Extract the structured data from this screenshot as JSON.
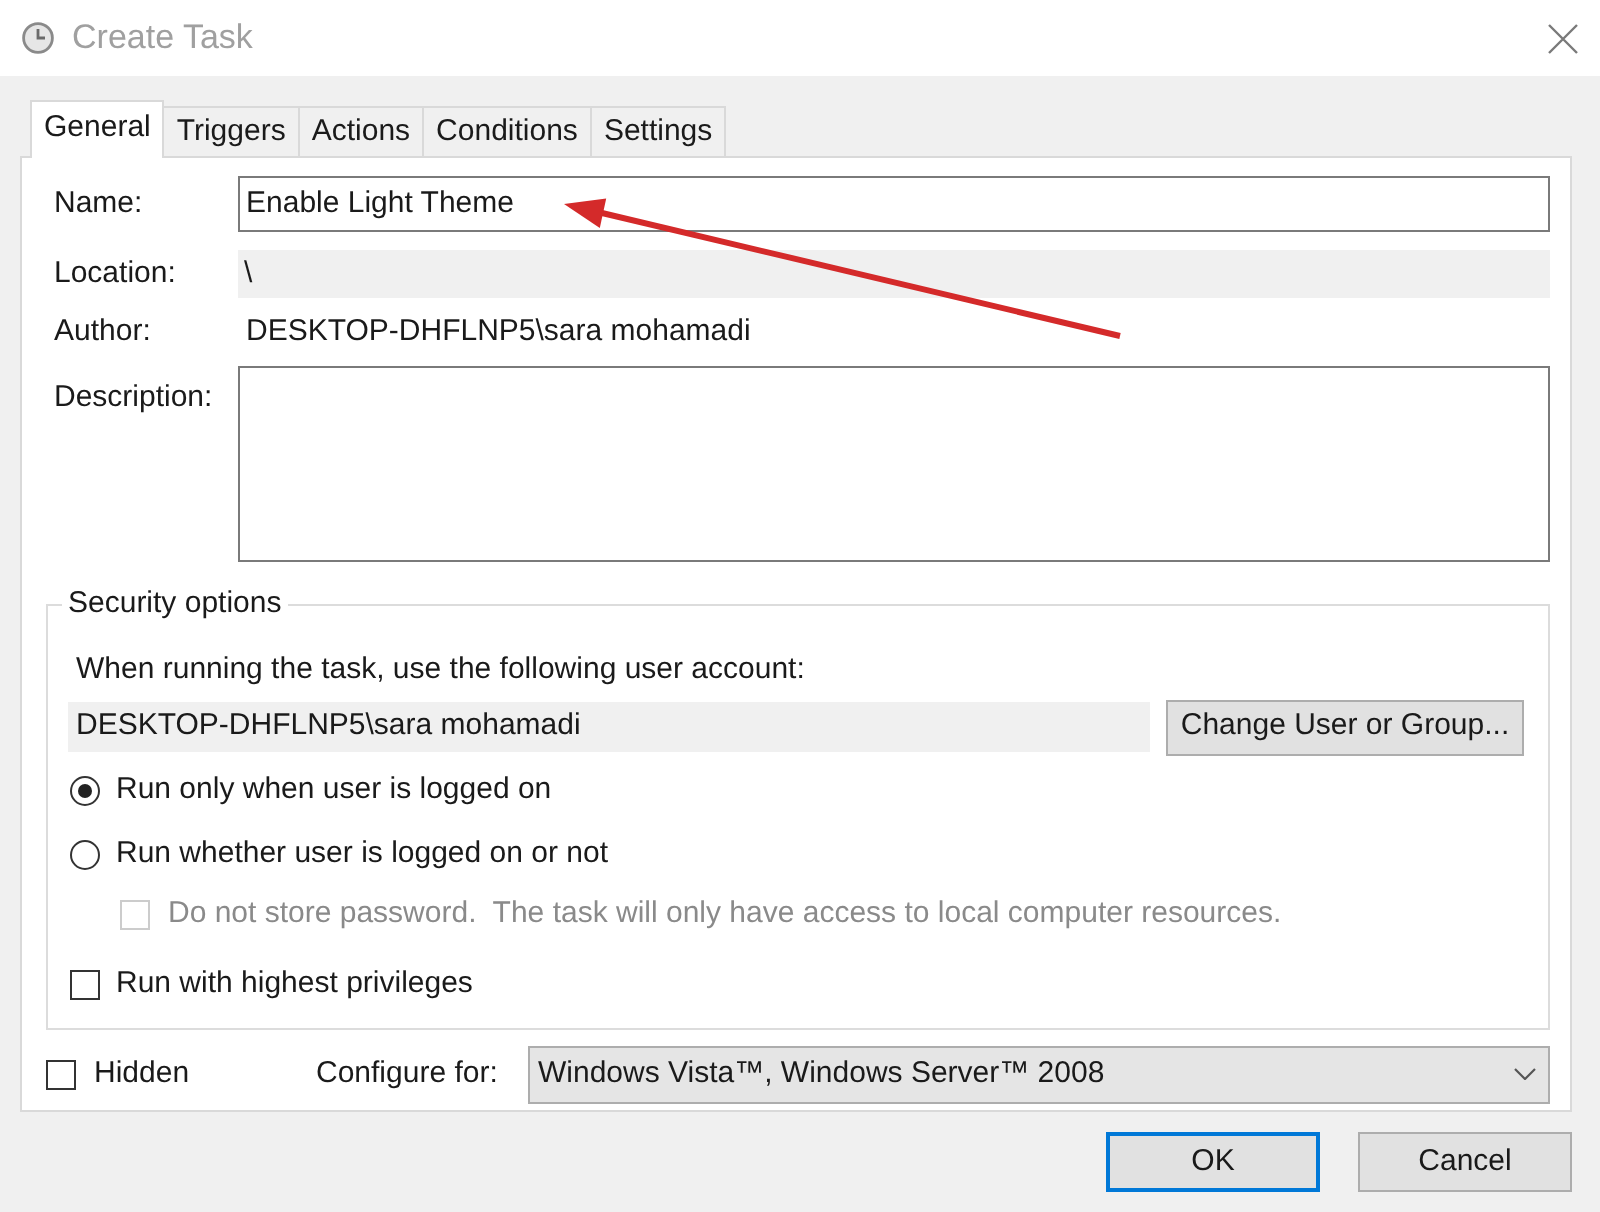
{
  "window": {
    "title": "Create Task"
  },
  "tabs": [
    {
      "label": "General",
      "selected": true
    },
    {
      "label": "Triggers",
      "selected": false
    },
    {
      "label": "Actions",
      "selected": false
    },
    {
      "label": "Conditions",
      "selected": false
    },
    {
      "label": "Settings",
      "selected": false
    }
  ],
  "general": {
    "name": {
      "label": "Name:",
      "value": "Enable Light Theme"
    },
    "location": {
      "label": "Location:",
      "value": "\\"
    },
    "author": {
      "label": "Author:",
      "value": "DESKTOP-DHFLNP5\\sara mohamadi"
    },
    "description": {
      "label": "Description:"
    },
    "security_options": {
      "title": "Security options",
      "account_prompt": "When running the task, use the following user account:",
      "account": "DESKTOP-DHFLNP5\\sara mohamadi",
      "change_button": "Change User or Group...",
      "logon_options": [
        {
          "label": "Run only when user is logged on",
          "selected": true
        },
        {
          "label": "Run whether user is logged on or not",
          "selected": false
        }
      ],
      "do_not_store_password": {
        "label": "Do not store password.  The task will only have access to local computer resources.",
        "checked": false,
        "disabled": true
      },
      "highest_privileges": {
        "label": "Run with highest privileges",
        "checked": false
      }
    },
    "hidden": {
      "label": "Hidden",
      "checked": false
    },
    "configure_for": {
      "label": "Configure for:",
      "value": "Windows Vista™, Windows Server™ 2008"
    }
  },
  "buttons": [
    {
      "label": "OK",
      "focused": true
    },
    {
      "label": "Cancel",
      "focused": false
    }
  ]
}
